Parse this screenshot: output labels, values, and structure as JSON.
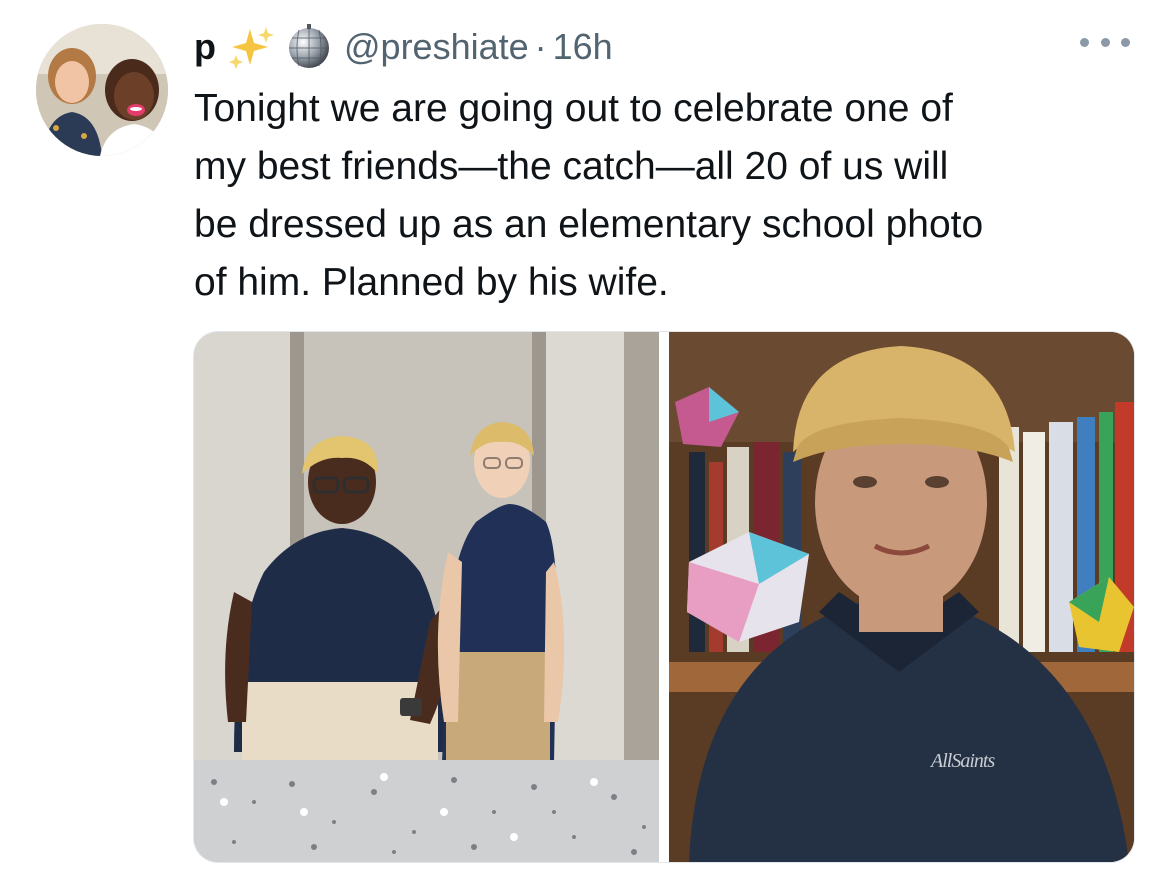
{
  "tweet": {
    "display_name": "p",
    "emojis": [
      "sparkles-icon",
      "mirror-ball-icon"
    ],
    "handle": "@preshiate",
    "separator": "·",
    "timestamp": "16h",
    "text_lines": [
      "Tonight we are going out to celebrate one of",
      "my best friends—the catch—all 20 of us will",
      "be dressed up as an elementary school photo",
      "of him. Planned by his wife."
    ],
    "photo_right_shirt_logo": "AllSaints"
  },
  "colors": {
    "text": "#0f1419",
    "secondary": "#536471",
    "sparkle": "#f5c542",
    "navy_shirt": "#1f2c47"
  }
}
